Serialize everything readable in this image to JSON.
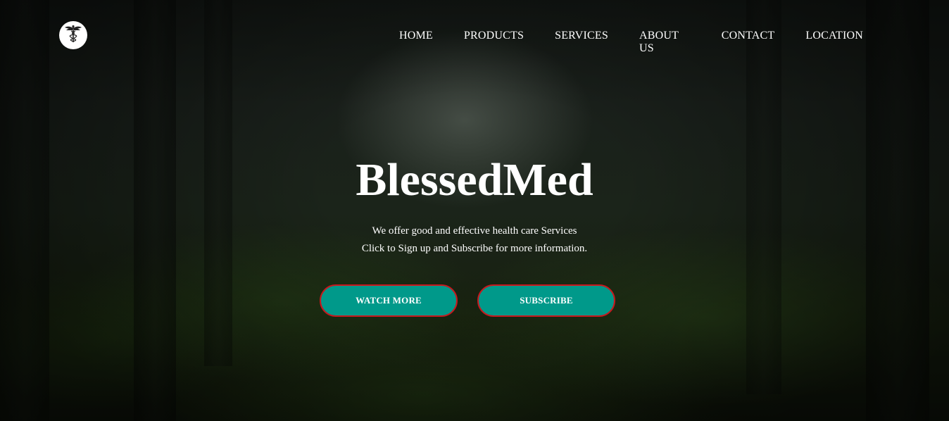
{
  "brand": {
    "logo_icon": "caduceus-icon",
    "title": "BlessedMed"
  },
  "nav": {
    "items": [
      {
        "label": "HOME"
      },
      {
        "label": "PRODUCTS"
      },
      {
        "label": "SERVICES"
      },
      {
        "label": "ABOUT US"
      },
      {
        "label": "CONTACT"
      },
      {
        "label": "LOCATION"
      }
    ]
  },
  "hero": {
    "line1": "We offer good and effective health care Services",
    "line2": "Click to Sign up and Subscribe for more information.",
    "watch_label": "WATCH MORE",
    "subscribe_label": "SUBSCRIBE"
  },
  "colors": {
    "button_fill": "#00998a",
    "button_border": "#c8181e",
    "text": "#ffffff"
  }
}
